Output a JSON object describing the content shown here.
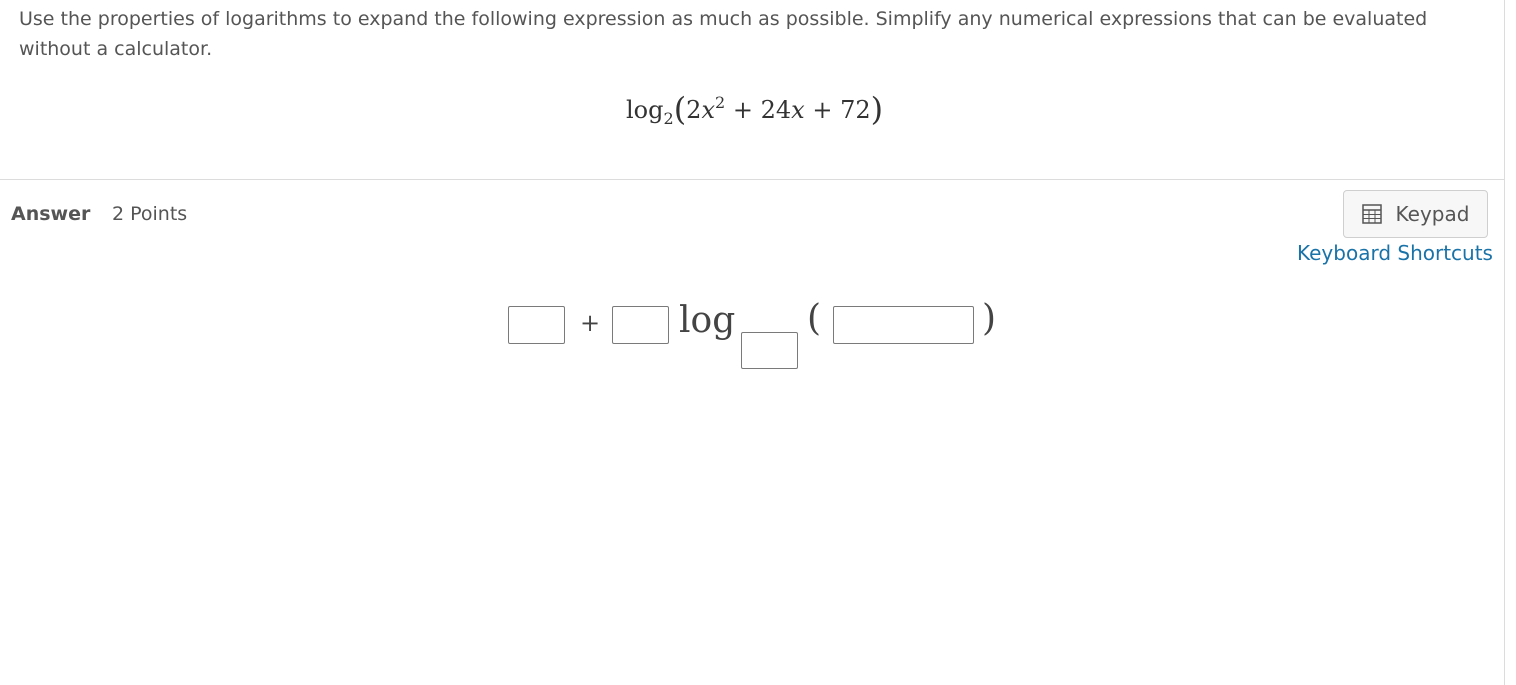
{
  "question": {
    "prompt": "Use the properties of logarithms to expand the following expression as much as possible. Simplify any numerical expressions that can be evaluated without a calculator.",
    "expression": {
      "log": "log",
      "base": "2",
      "open_paren": "(",
      "term1_coef": "2",
      "term1_var": "x",
      "term1_exp": "2",
      "plus1": "+",
      "term2_coef": "24",
      "term2_var": "x",
      "plus2": "+",
      "term3": "72",
      "close_paren": ")"
    }
  },
  "answer": {
    "label": "Answer",
    "points": "2 Points",
    "keypad_label": "Keypad",
    "keypad_icon": "calculator-icon",
    "keyboard_shortcuts_label": "Keyboard Shortcuts",
    "template": {
      "plus": "+",
      "log": "log",
      "open_paren": "(",
      "close_paren": ")",
      "boxes": [
        "",
        "",
        "",
        ""
      ]
    }
  }
}
